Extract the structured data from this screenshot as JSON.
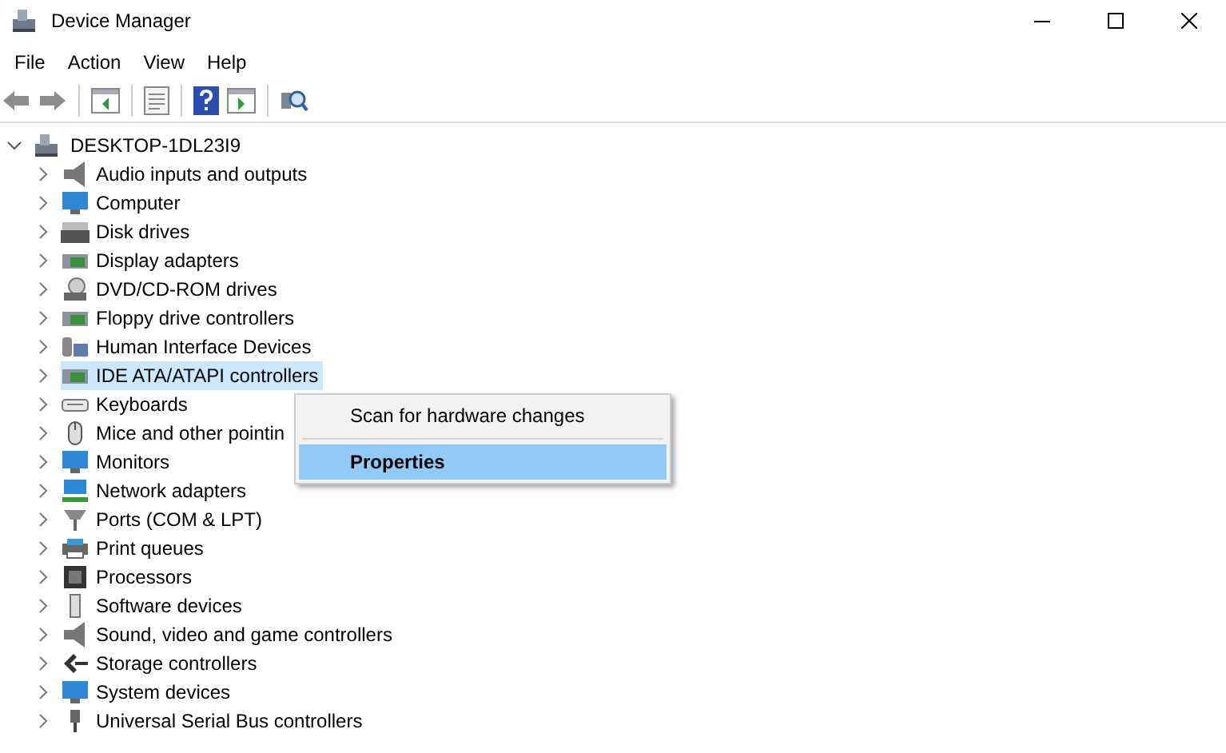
{
  "window": {
    "title": "Device Manager"
  },
  "menu": [
    "File",
    "Action",
    "View",
    "Help"
  ],
  "tree": {
    "label": "DESKTOP-1DL23I9",
    "expanded": true,
    "children": [
      {
        "label": "Audio inputs and outputs",
        "expanded": false,
        "selected": false
      },
      {
        "label": "Computer",
        "expanded": false,
        "selected": false
      },
      {
        "label": "Disk drives",
        "expanded": false,
        "selected": false
      },
      {
        "label": "Display adapters",
        "expanded": false,
        "selected": false
      },
      {
        "label": "DVD/CD-ROM drives",
        "expanded": false,
        "selected": false
      },
      {
        "label": "Floppy drive controllers",
        "expanded": false,
        "selected": false
      },
      {
        "label": "Human Interface Devices",
        "expanded": false,
        "selected": false
      },
      {
        "label": "IDE ATA/ATAPI controllers",
        "expanded": false,
        "selected": true
      },
      {
        "label": "Keyboards",
        "expanded": false,
        "selected": false
      },
      {
        "label": "Mice and other pointin",
        "expanded": false,
        "selected": false
      },
      {
        "label": "Monitors",
        "expanded": false,
        "selected": false
      },
      {
        "label": "Network adapters",
        "expanded": false,
        "selected": false
      },
      {
        "label": "Ports (COM & LPT)",
        "expanded": false,
        "selected": false
      },
      {
        "label": "Print queues",
        "expanded": false,
        "selected": false
      },
      {
        "label": "Processors",
        "expanded": false,
        "selected": false
      },
      {
        "label": "Software devices",
        "expanded": false,
        "selected": false
      },
      {
        "label": "Sound, video and game controllers",
        "expanded": false,
        "selected": false
      },
      {
        "label": "Storage controllers",
        "expanded": false,
        "selected": false
      },
      {
        "label": "System devices",
        "expanded": false,
        "selected": false
      },
      {
        "label": "Universal Serial Bus controllers",
        "expanded": false,
        "selected": false
      }
    ]
  },
  "context_menu": {
    "items": [
      {
        "label": "Scan for hardware changes",
        "default": false,
        "selected": false
      },
      {
        "label": "Properties",
        "default": true,
        "selected": true
      }
    ]
  }
}
